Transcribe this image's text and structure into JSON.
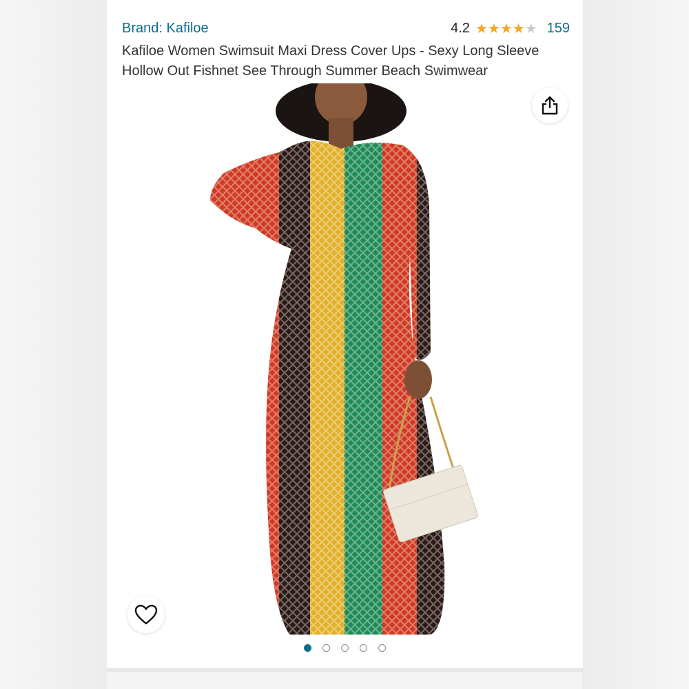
{
  "product": {
    "brand_label": "Brand: Kafiloe",
    "rating_value": "4.2",
    "rating_stars": 4.2,
    "rating_count": "159",
    "title": "Kafiloe Women Swimsuit Maxi Dress Cover Ups - Sexy Long Sleeve Hollow Out Fishnet See Through Summer Beach Swimwear"
  },
  "gallery": {
    "image_count": 5,
    "active_index": 0
  },
  "colors": {
    "link": "#0e6e8c",
    "star": "#f5a623",
    "active_dot": "#0e6e8c"
  },
  "icons": {
    "share": "share-icon",
    "favorite": "heart-icon"
  }
}
